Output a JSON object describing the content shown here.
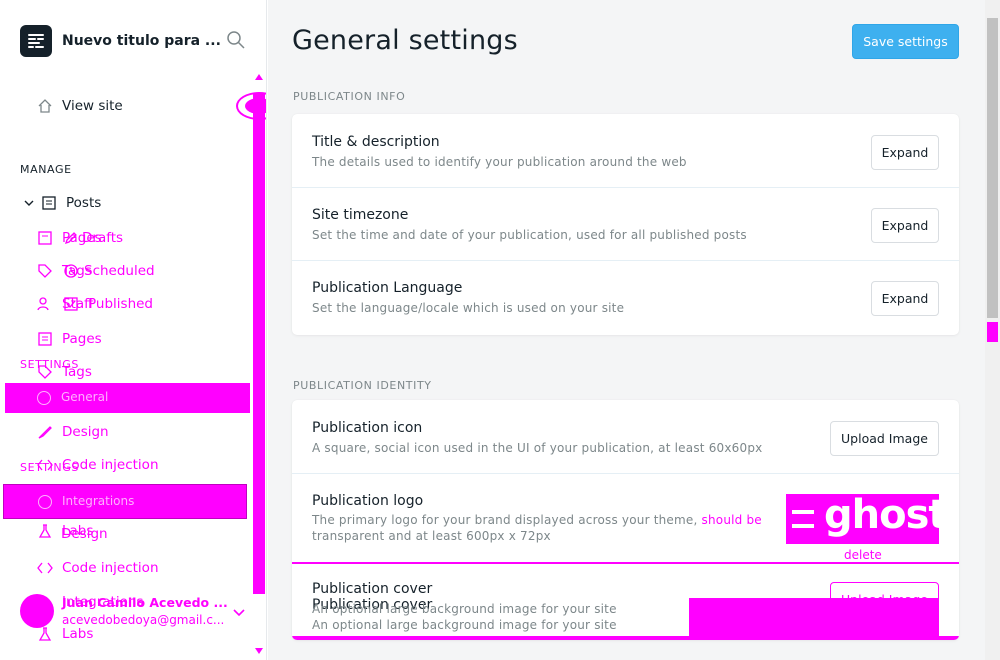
{
  "app": {
    "site_title": "Nuevo titulo para ...",
    "view_site": "View site"
  },
  "sidebar": {
    "manage_heading": "MANAGE",
    "settings_heading": "SETTINGS",
    "manage_items": [
      {
        "label": "Posts",
        "icon": "posts-icon"
      },
      {
        "label": "Drafts",
        "icon": "edit-icon"
      },
      {
        "label": "Scheduled",
        "icon": "clock-icon"
      },
      {
        "label": "Published",
        "icon": "check-icon"
      },
      {
        "label": "Pages",
        "icon": "pages-icon"
      },
      {
        "label": "Tags",
        "icon": "tag-icon"
      },
      {
        "label": "Staff",
        "icon": "staff-icon"
      }
    ],
    "ghost_overlay_items": [
      "Pages",
      "Tags",
      "Staff"
    ],
    "settings_items": [
      {
        "label": "General",
        "icon": "gear-icon"
      },
      {
        "label": "Design",
        "icon": "brush-icon"
      },
      {
        "label": "Code injection",
        "icon": "code-icon"
      },
      {
        "label": "Integrations",
        "icon": "plug-icon"
      },
      {
        "label": "Labs",
        "icon": "flask-icon"
      }
    ],
    "duplicate_settings_heading": "SETTINGS",
    "duplicate_items": [
      "Design",
      "Code injection",
      "Integrations",
      "Labs"
    ],
    "user": {
      "name": "Juan Camilo Acevedo ...",
      "email": "acevedobedoya@gmail.c..."
    }
  },
  "main": {
    "title": "General settings",
    "save_label": "Save settings",
    "groups": [
      {
        "heading": "PUBLICATION INFO",
        "rows": [
          {
            "title": "Title & description",
            "desc": "The details used to identify your publication around the web",
            "button": "Expand"
          },
          {
            "title": "Site timezone",
            "desc": "Set the time and date of your publication, used for all published posts",
            "button": "Expand"
          },
          {
            "title": "Publication Language",
            "desc": "Set the language/locale which is used on your site",
            "button": "Expand"
          }
        ]
      },
      {
        "heading": "PUBLICATION IDENTITY",
        "rows": [
          {
            "title": "Publication icon",
            "desc": "A square, social icon used in the UI of your publication, at least 60x60px",
            "button": "Upload Image"
          },
          {
            "title": "Publication logo",
            "desc": "The primary logo for your brand displayed across your theme,",
            "desc_extra": "should be",
            "desc_line2": "transparent and at least 600px x 72px",
            "logo_text": "ghost",
            "delete_label": "delete"
          },
          {
            "title": "Publication cover",
            "desc": "An optional large background image for your site",
            "desc_line2": "An optional large background image for your site",
            "button": "Upload Image"
          }
        ]
      }
    ]
  },
  "colors": {
    "accent": "#3eb0ef",
    "overlay": "#ff00ff",
    "text": "#15212a",
    "muted": "#7d878a"
  }
}
